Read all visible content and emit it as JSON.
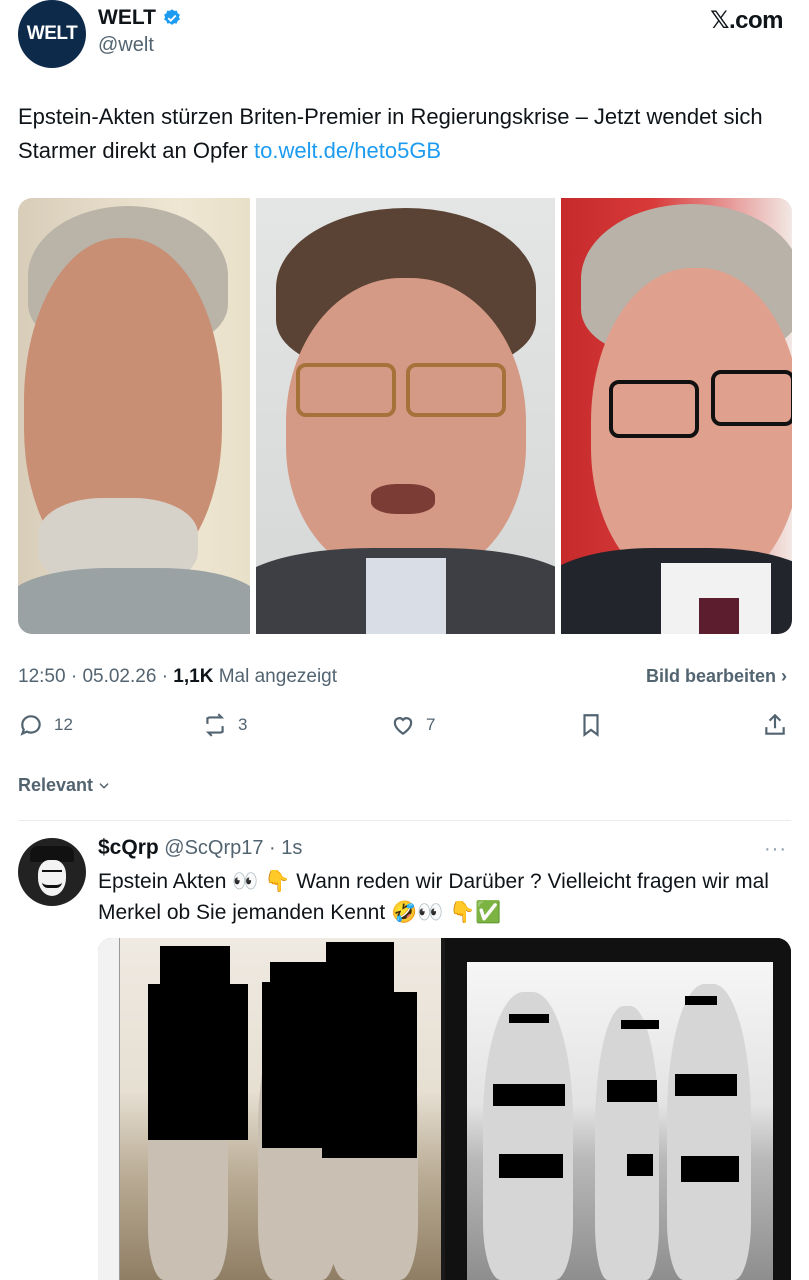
{
  "tweet": {
    "avatar_text": "WELT",
    "author_name": "WELT",
    "author_handle": "@welt",
    "platform_logo": "𝕏.com",
    "text": "Epstein-Akten stürzen Briten-Premier in Regierungskrise – Jetzt wendet sich Starmer direkt an Opfer ",
    "link": "to.welt.de/heto5GB",
    "time": "12:50",
    "date": "05.02.26",
    "views_count": "1,1K",
    "views_label": "Mal angezeigt",
    "edit_image_label": "Bild bearbeiten",
    "replies": "12",
    "reposts": "3",
    "likes": "7",
    "icons": [
      "reply-icon",
      "repost-icon",
      "like-icon",
      "bookmark-icon",
      "share-icon",
      "verified-icon"
    ],
    "colors": {
      "link": "#1d9bf0",
      "verified": "#1d9bf0",
      "muted": "#536471"
    }
  },
  "sort": {
    "label": "Relevant"
  },
  "reply": {
    "name": "$cQrp",
    "handle": "@ScQrp17",
    "time": "1s",
    "text": "Epstein Akten 👀 👇 Wann reden wir Darüber ? Vielleicht fragen wir mal Merkel ob Sie jemanden Kennt 🤣👀 👇✅"
  }
}
